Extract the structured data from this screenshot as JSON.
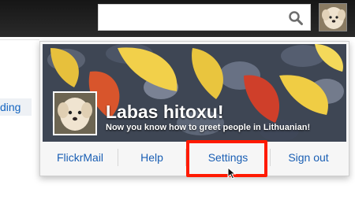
{
  "search": {
    "value": "",
    "placeholder": ""
  },
  "left_link": {
    "label": "ding"
  },
  "profile": {
    "title": "Labas hitoxu!",
    "subtitle": "Now you know how to greet people in Lithuanian!"
  },
  "menu": {
    "items": [
      {
        "label": "FlickrMail"
      },
      {
        "label": "Help"
      },
      {
        "label": "Settings"
      },
      {
        "label": "Sign out"
      }
    ]
  },
  "colors": {
    "topbar": "#1e1e1e",
    "link": "#1a5fb4",
    "highlight": "#ff1a00"
  },
  "icons": {
    "search": "search-icon",
    "cursor": "pointer-cursor-icon"
  }
}
